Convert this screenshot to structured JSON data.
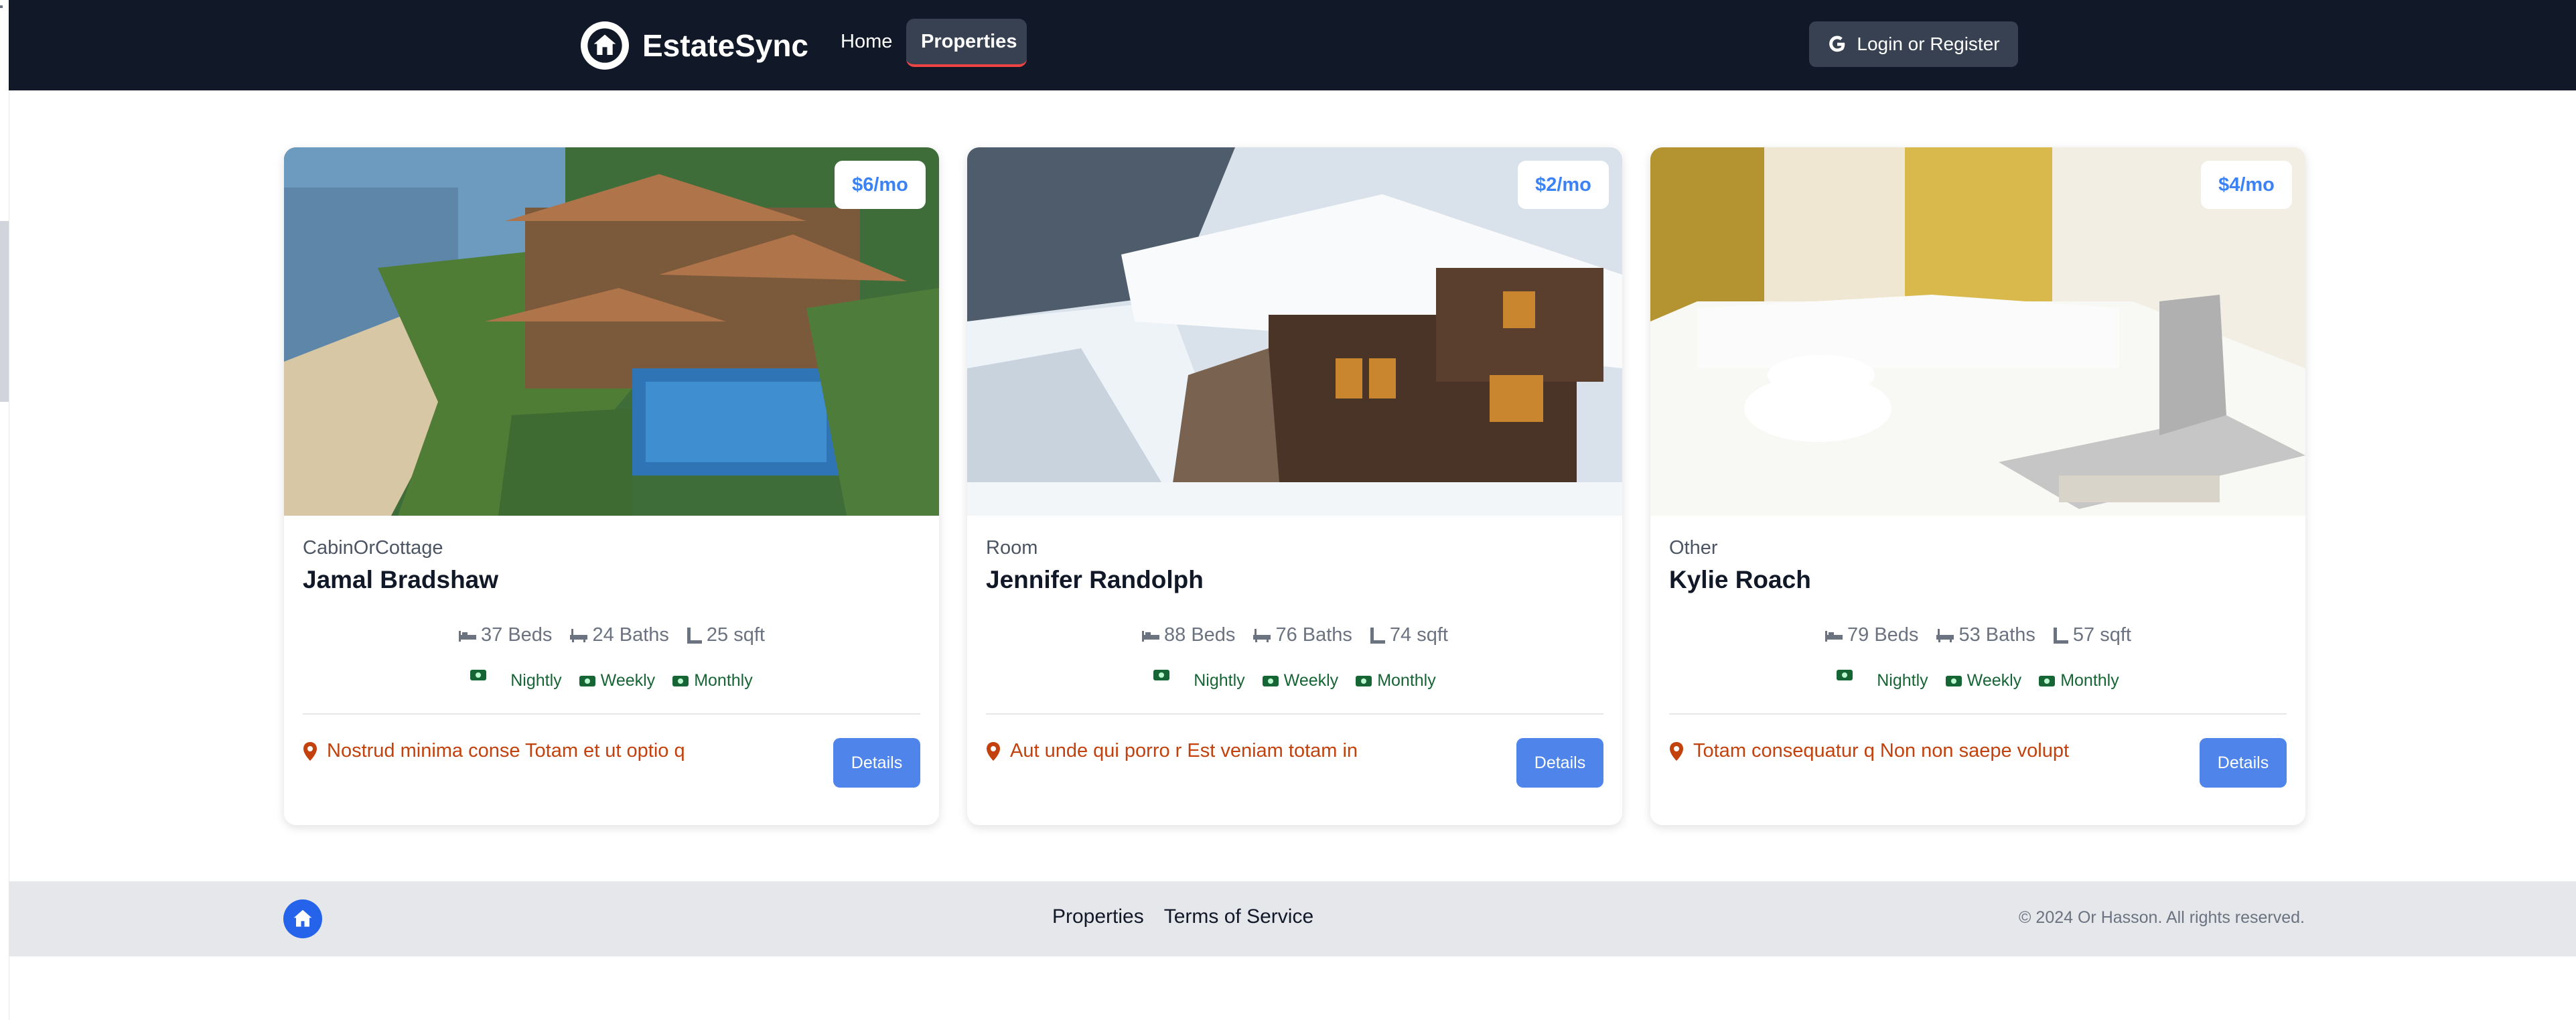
{
  "app": {
    "name": "EstateSync"
  },
  "nav": {
    "links": [
      "Home",
      "Properties"
    ],
    "active": "Properties",
    "login_label": "Login or Register"
  },
  "properties": [
    {
      "price": "$6/mo",
      "type": "CabinOrCottage",
      "name": "Jamal Bradshaw",
      "beds": "37 Beds",
      "baths": "24 Baths",
      "sqft": "25 sqft",
      "rates": [
        "Nightly",
        "Weekly",
        "Monthly"
      ],
      "location": "Nostrud minima conse Totam et ut optio q",
      "details_label": "Details",
      "image": "resort-villa-photo"
    },
    {
      "price": "$2/mo",
      "type": "Room",
      "name": "Jennifer Randolph",
      "beds": "88 Beds",
      "baths": "76 Baths",
      "sqft": "74 sqft",
      "rates": [
        "Nightly",
        "Weekly",
        "Monthly"
      ],
      "location": "Aut unde qui porro r Est veniam totam in",
      "details_label": "Details",
      "image": "snowy-cabin-photo"
    },
    {
      "price": "$4/mo",
      "type": "Other",
      "name": "Kylie Roach",
      "beds": "79 Beds",
      "baths": "53 Baths",
      "sqft": "57 sqft",
      "rates": [
        "Nightly",
        "Weekly",
        "Monthly"
      ],
      "location": "Totam consequatur q Non non saepe volupt",
      "details_label": "Details",
      "image": "bedroom-laptop-photo"
    }
  ],
  "footer": {
    "links": [
      "Properties",
      "Terms of Service"
    ],
    "copyright": "© 2024 Or Hasson. All rights reserved."
  },
  "icons": {
    "logo": "house-icon",
    "login": "google-icon",
    "beds": "bed-icon",
    "baths": "bathtub-icon",
    "sqft": "ruler-icon",
    "rate": "money-icon",
    "location": "map-pin-icon"
  },
  "colors": {
    "nav_bg": "#111827",
    "active_tab_bg": "#374151",
    "active_tab_underline": "#ef4444",
    "price": "#3b82f6",
    "details_button": "#4f85ea",
    "location_text": "#c2410c",
    "rate_text": "#166534",
    "footer_bg": "#e5e7eb"
  }
}
